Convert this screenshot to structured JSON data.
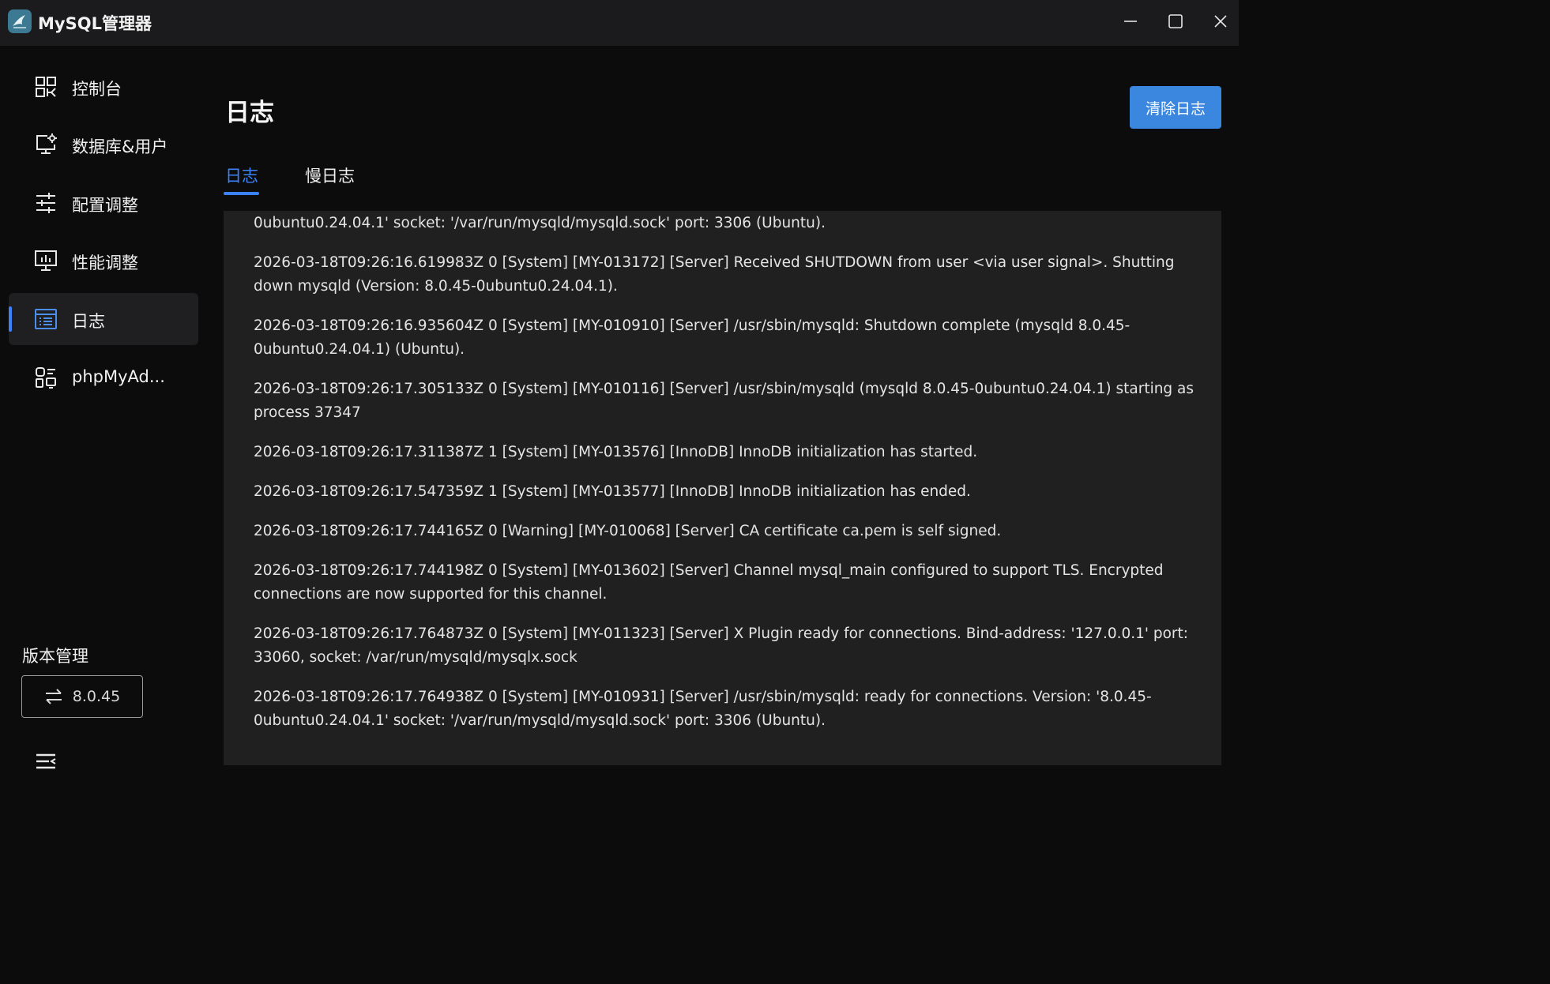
{
  "window": {
    "title": "MySQL管理器"
  },
  "sidebar": {
    "items": [
      {
        "label": "控制台",
        "icon": "dashboard-icon"
      },
      {
        "label": "数据库&用户",
        "icon": "monitor-settings-icon"
      },
      {
        "label": "配置调整",
        "icon": "sliders-icon"
      },
      {
        "label": "性能调整",
        "icon": "performance-monitor-icon"
      },
      {
        "label": "日志",
        "icon": "log-list-icon",
        "active": true
      },
      {
        "label": "phpMyAd...",
        "icon": "phpmyadmin-icon"
      }
    ],
    "version_section_title": "版本管理",
    "version_value": "8.0.45"
  },
  "main": {
    "title": "日志",
    "clear_button": "清除日志",
    "tabs": [
      {
        "label": "日志",
        "active": true
      },
      {
        "label": "慢日志",
        "active": false
      }
    ],
    "log_lines": [
      "0ubuntu0.24.04.1' socket: '/var/run/mysqld/mysqld.sock' port: 3306 (Ubuntu).",
      "2026-03-18T09:26:16.619983Z 0 [System] [MY-013172] [Server] Received SHUTDOWN from user <via user signal>. Shutting down mysqld (Version: 8.0.45-0ubuntu0.24.04.1).",
      "2026-03-18T09:26:16.935604Z 0 [System] [MY-010910] [Server] /usr/sbin/mysqld: Shutdown complete (mysqld 8.0.45-0ubuntu0.24.04.1) (Ubuntu).",
      "2026-03-18T09:26:17.305133Z 0 [System] [MY-010116] [Server] /usr/sbin/mysqld (mysqld 8.0.45-0ubuntu0.24.04.1) starting as process 37347",
      "2026-03-18T09:26:17.311387Z 1 [System] [MY-013576] [InnoDB] InnoDB initialization has started.",
      "2026-03-18T09:26:17.547359Z 1 [System] [MY-013577] [InnoDB] InnoDB initialization has ended.",
      "2026-03-18T09:26:17.744165Z 0 [Warning] [MY-010068] [Server] CA certificate ca.pem is self signed.",
      "2026-03-18T09:26:17.744198Z 0 [System] [MY-013602] [Server] Channel mysql_main configured to support TLS. Encrypted connections are now supported for this channel.",
      "2026-03-18T09:26:17.764873Z 0 [System] [MY-011323] [Server] X Plugin ready for connections. Bind-address: '127.0.0.1' port: 33060, socket: /var/run/mysqld/mysqlx.sock",
      "2026-03-18T09:26:17.764938Z 0 [System] [MY-010931] [Server] /usr/sbin/mysqld: ready for connections. Version: '8.0.45-0ubuntu0.24.04.1' socket: '/var/run/mysqld/mysqld.sock' port: 3306 (Ubuntu)."
    ]
  },
  "colors": {
    "accent": "#3b82f6",
    "button": "#3b87e0",
    "background": "#0c0c0c",
    "panel": "#202020"
  }
}
